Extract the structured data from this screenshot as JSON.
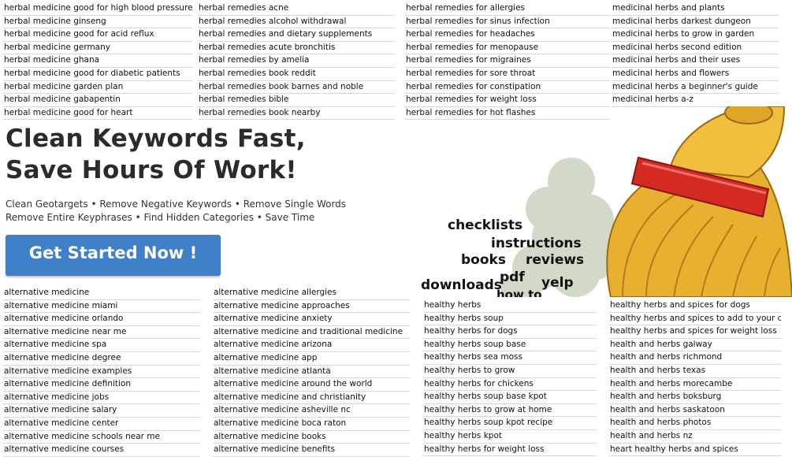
{
  "top_keywords": [
    [
      "herbal medicine good for high blood pressure",
      "herbal medicine ginseng",
      "herbal medicine good for acid reflux",
      "herbal medicine germany",
      "herbal medicine ghana",
      "herbal medicine good for diabetic patients",
      "herbal medicine garden plan",
      "herbal medicine gabapentin",
      "herbal medicine good for heart"
    ],
    [
      "herbal remedies acne",
      "herbal remedies alcohol withdrawal",
      "herbal remedies and dietary supplements",
      "herbal remedies acute bronchitis",
      "herbal remedies by amelia",
      "herbal remedies book reddit",
      "herbal remedies book barnes and noble",
      "herbal remedies bible",
      "herbal remedies book nearby"
    ],
    [
      "herbal remedies for allergies",
      "herbal remedies for sinus infection",
      "herbal remedies for headaches",
      "herbal remedies for menopause",
      "herbal remedies for migraines",
      "herbal remedies for sore throat",
      "herbal remedies for constipation",
      "herbal remedies for weight loss",
      "herbal remedies for hot flashes"
    ],
    [
      "medicinal herbs and plants",
      "medicinal herbs darkest dungeon",
      "medicinal herbs to grow in garden",
      "medicinal herbs second edition",
      "medicinal herbs and their uses",
      "medicinal herbs and flowers",
      "medicinal herbs a beginner's guide",
      "medicinal herbs a-z"
    ]
  ],
  "hero": {
    "headline_line1": "Clean Keywords Fast,",
    "headline_line2": "Save Hours Of Work!",
    "features_line1": "Clean Geotargets • Remove Negative Keywords • Remove Single Words",
    "features_line2": "Remove Entire Keyphrases • Find Hidden Categories • Save Time",
    "cta_label": "Get Started Now !"
  },
  "cloud_words": [
    "checklists",
    "instructions",
    "books",
    "reviews",
    "pdf",
    "downloads",
    "yelp",
    "how to"
  ],
  "bottom_keywords": [
    [
      "alternative medicine",
      "alternative medicine miami",
      "alternative medicine orlando",
      "alternative medicine near me",
      "alternative medicine spa",
      "alternative medicine degree",
      "alternative medicine examples",
      "alternative medicine definition",
      "alternative medicine jobs",
      "alternative medicine salary",
      "alternative medicine center",
      "alternative medicine schools near me",
      "alternative medicine courses"
    ],
    [
      "alternative medicine allergies",
      "alternative medicine approaches",
      "alternative medicine anxiety",
      "alternative medicine and traditional medicine",
      "alternative medicine arizona",
      "alternative medicine app",
      "alternative medicine atlanta",
      "alternative medicine around the world",
      "alternative medicine and christianity",
      "alternative medicine asheville nc",
      "alternative medicine boca raton",
      "alternative medicine books",
      "alternative medicine benefits"
    ],
    [
      "healthy herbs",
      "healthy herbs soup",
      "healthy herbs for dogs",
      "healthy herbs soup base",
      "healthy herbs sea moss",
      "healthy herbs to grow",
      "healthy herbs for chickens",
      "healthy herbs soup base kpot",
      "healthy herbs to grow at home",
      "healthy herbs soup kpot recipe",
      "healthy herbs kpot",
      "healthy herbs for weight loss"
    ],
    [
      "healthy herbs and spices for dogs",
      "healthy herbs and spices to add to your diet",
      "healthy herbs and spices for weight loss",
      "health and herbs galway",
      "health and herbs richmond",
      "health and herbs texas",
      "health and herbs morecambe",
      "health and herbs boksburg",
      "health and herbs saskatoon",
      "health and herbs photos",
      "health and herbs nz",
      "heart healthy herbs and spices"
    ]
  ],
  "colors": {
    "cta": "#3f80c9",
    "broom": "#e8b030",
    "band": "#d42a22",
    "cloud": "#c9d3c0"
  }
}
